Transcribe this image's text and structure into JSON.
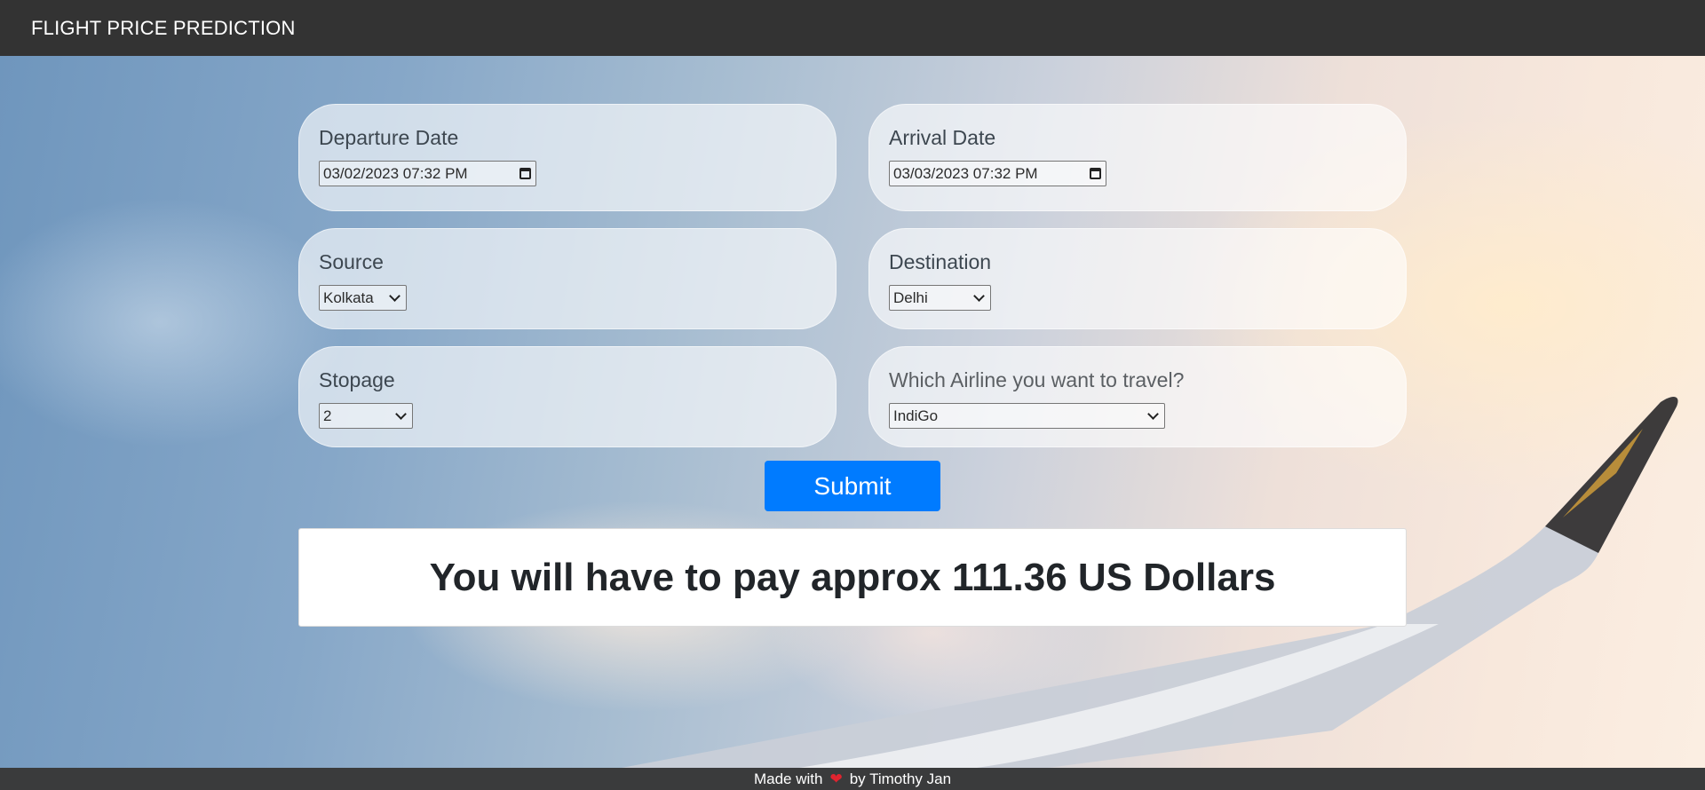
{
  "navbar": {
    "brand": "FLIGHT PRICE PREDICTION"
  },
  "form": {
    "departure": {
      "label": "Departure Date",
      "value": "03/02/2023 07:32 PM"
    },
    "arrival": {
      "label": "Arrival Date",
      "value": "03/03/2023 07:32 PM"
    },
    "source": {
      "label": "Source",
      "selected": "Kolkata"
    },
    "destination": {
      "label": "Destination",
      "selected": "Delhi"
    },
    "stopage": {
      "label": "Stopage",
      "selected": "2"
    },
    "airline": {
      "label": "Which Airline you want to travel?",
      "selected": "IndiGo"
    },
    "submit_label": "Submit"
  },
  "result": {
    "text": "You will have to pay approx 111.36 US Dollars"
  },
  "footer": {
    "prefix": "Made with",
    "suffix": "by Timothy Jan",
    "icon": "heart-icon"
  },
  "colors": {
    "navbar_bg": "#333333",
    "submit_bg": "#007bff",
    "heart": "#e0242f"
  }
}
